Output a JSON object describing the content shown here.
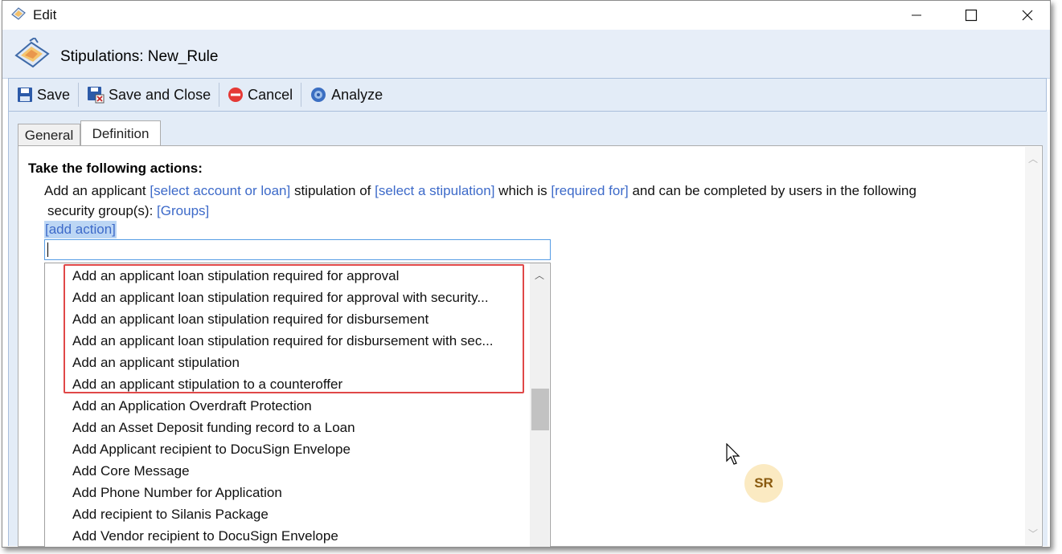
{
  "window": {
    "title": "Edit"
  },
  "header": {
    "title": "Stipulations: New_Rule"
  },
  "toolbar": {
    "save_label": "Save",
    "save_close_label": "Save and Close",
    "cancel_label": "Cancel",
    "analyze_label": "Analyze"
  },
  "tabs": [
    {
      "label": "General",
      "selected": false
    },
    {
      "label": "Definition",
      "selected": true
    }
  ],
  "definition": {
    "heading": "Take the following actions:",
    "sentence": {
      "part1": "Add an applicant ",
      "link1": "[select account or loan]",
      "part2": " stipulation of ",
      "link2": "[select a stipulation]",
      "part3": " which is ",
      "link3": "[required for]",
      "part4": " and can be completed by users in the following",
      "part5": "security group(s): ",
      "link4": "[Groups]"
    },
    "add_action_label": "[add action]",
    "filter_value": ""
  },
  "dropdown": {
    "items": [
      "Add an applicant loan stipulation required for approval",
      "Add an applicant loan stipulation required for approval with security...",
      "Add an applicant loan stipulation required for disbursement",
      "Add an applicant loan stipulation required for disbursement with sec...",
      "Add an applicant stipulation",
      "Add an applicant stipulation to a counteroffer",
      "Add an Application Overdraft Protection",
      "Add an Asset Deposit funding record to a Loan",
      "Add Applicant recipient to DocuSign Envelope",
      "Add Core Message",
      "Add Phone Number for Application",
      "Add recipient to Silanis Package",
      "Add Vendor recipient to DocuSign Envelope"
    ]
  },
  "avatar": {
    "initials": "SR"
  },
  "colors": {
    "link": "#3d6ac9",
    "highlight_border": "#e04848",
    "avatar_bg": "#fbeac2"
  }
}
